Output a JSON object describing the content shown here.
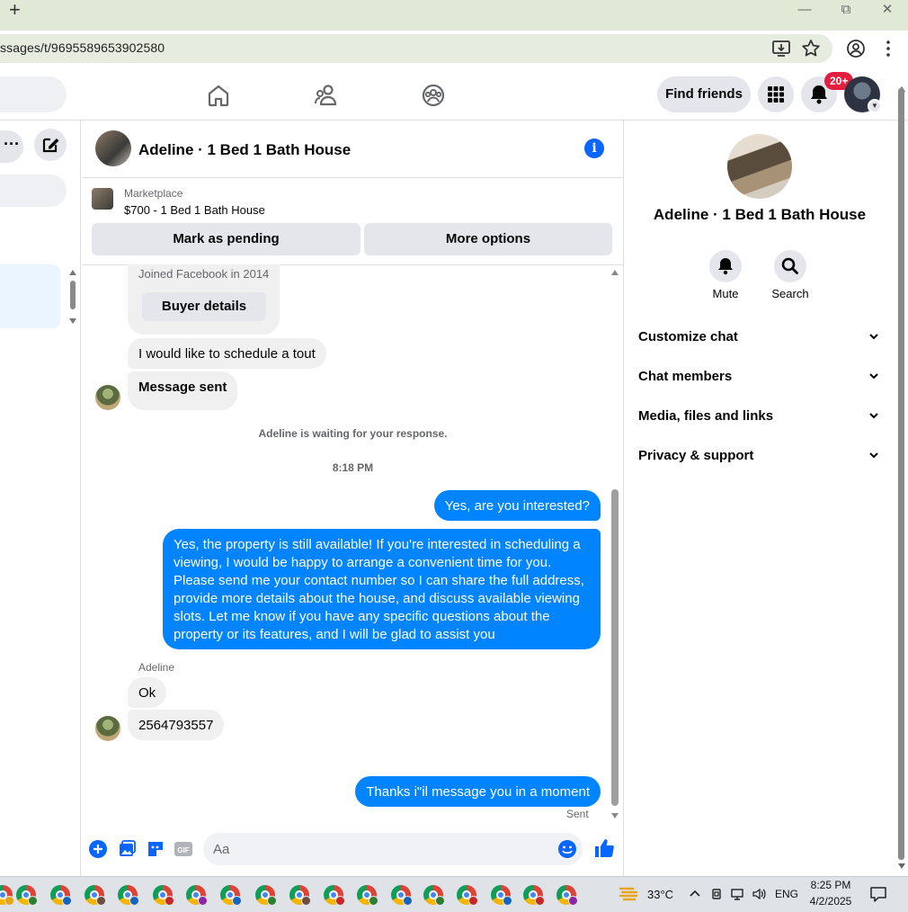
{
  "browser": {
    "url": "ssages/t/9695589653902580",
    "new_tab_label": "+",
    "window_controls": [
      "minimize",
      "restore",
      "close"
    ]
  },
  "header": {
    "find_friends_label": "Find friends",
    "notification_badge": "20+",
    "nav_icons": [
      "home-icon",
      "friends-icon",
      "groups-icon"
    ]
  },
  "chat": {
    "title": "Adeline · 1 Bed 1 Bath House",
    "marketplace": {
      "label": "Marketplace",
      "listing": "$700 - 1 Bed 1 Bath House"
    },
    "actions": {
      "mark_pending": "Mark as pending",
      "more_options": "More options"
    },
    "messages": {
      "joined": "Joined Facebook in 2014",
      "buyer_details": "Buyer details",
      "in1": "I would like to schedule a tout",
      "in2": "Message sent",
      "waiting_note": "Adeline is waiting for your response.",
      "timestamp": "8:18 PM",
      "out1": "Yes, are you interested?",
      "out2": "Yes, the property is still available! If you're interested in scheduling a viewing, I would be happy to arrange a convenient time for you. Please send me your contact number so I can share the full address, provide more details about the house, and discuss available viewing slots. Let me know if you have any specific questions about the property or its features, and I will be glad to assist you",
      "sender_name": "Adeline",
      "in3": "Ok",
      "in4": "2564793557",
      "out3": "Thanks i\"il message you in a moment",
      "sent_status": "Sent"
    },
    "composer": {
      "placeholder": "Aa"
    }
  },
  "details": {
    "title": "Adeline · 1 Bed 1 Bath House",
    "mute_label": "Mute",
    "search_label": "Search",
    "sections": [
      "Customize chat",
      "Chat members",
      "Media, files and links",
      "Privacy & support"
    ]
  },
  "taskbar": {
    "temperature": "33°C",
    "language": "ENG",
    "time": "8:25 PM",
    "date": "4/2/2025"
  },
  "colors": {
    "accent": "#0866ff",
    "outgoing_bubble": "#0084ff",
    "incoming_bubble": "#f0f0f0",
    "badge": "#e41e3f"
  }
}
